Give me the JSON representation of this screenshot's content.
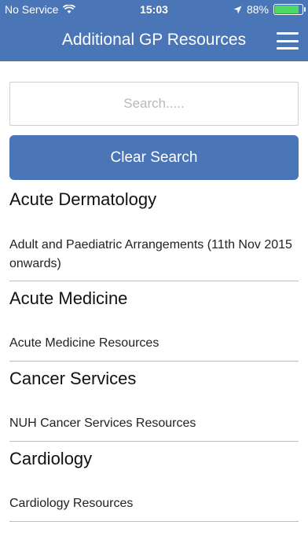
{
  "status_bar": {
    "carrier": "No Service",
    "time": "15:03",
    "battery": "88%",
    "battery_level": 0.88
  },
  "header": {
    "title": "Additional GP Resources",
    "menu_icon": "hamburger-menu-icon"
  },
  "search": {
    "placeholder": "Search.....",
    "value": "",
    "clear_label": "Clear Search"
  },
  "colors": {
    "header_bg": "#4a76b8",
    "button_bg": "#4a76b8",
    "battery_fill": "#4cd964"
  },
  "sections": [
    {
      "heading": "Acute Dermatology",
      "item": "Adult and Paediatric Arrangements (11th Nov 2015 onwards)"
    },
    {
      "heading": "Acute Medicine",
      "item": "Acute Medicine Resources"
    },
    {
      "heading": "Cancer Services",
      "item": "NUH Cancer Services Resources"
    },
    {
      "heading": "Cardiology",
      "item": "Cardiology Resources"
    }
  ]
}
